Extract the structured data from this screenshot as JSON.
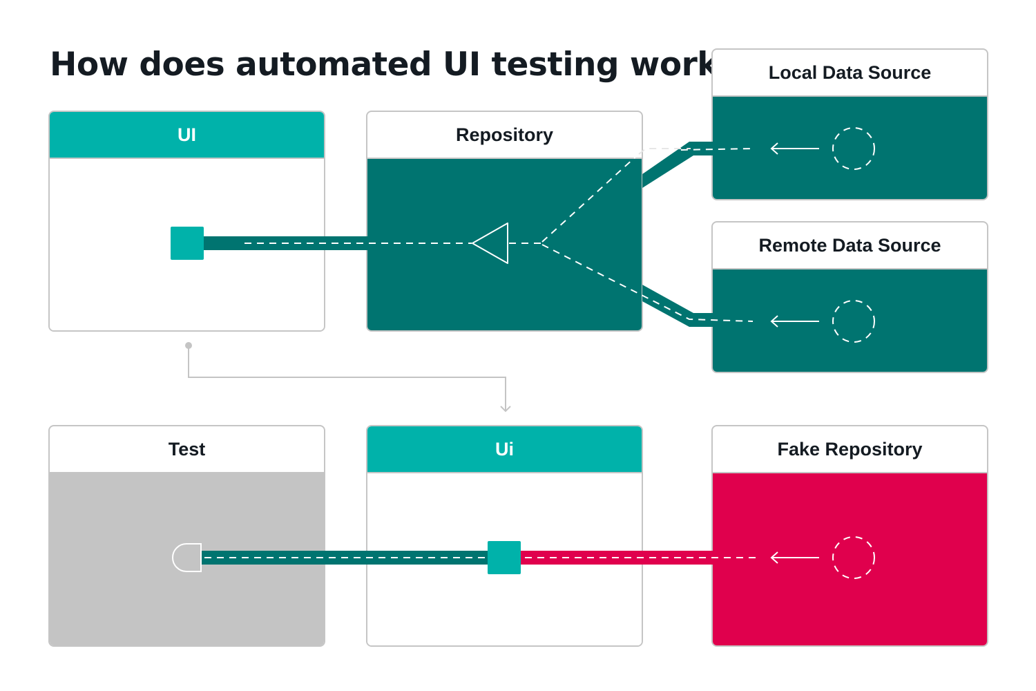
{
  "title": "How does automated UI testing work?",
  "colors": {
    "teal": "#00b2aa",
    "dark_teal": "#007470",
    "red": "#e0004d",
    "grey": "#c4c4c4",
    "border": "#c5c5c5",
    "text": "#141b22"
  },
  "production": {
    "ui": {
      "label": "UI"
    },
    "repository": {
      "label": "Repository"
    },
    "local_data_source": {
      "label": "Local Data Source"
    },
    "remote_data_source": {
      "label": "Remote Data Source"
    }
  },
  "test_setup": {
    "test": {
      "label": "Test"
    },
    "ui": {
      "label": "Ui"
    },
    "fake_repository": {
      "label": "Fake Repository"
    }
  }
}
